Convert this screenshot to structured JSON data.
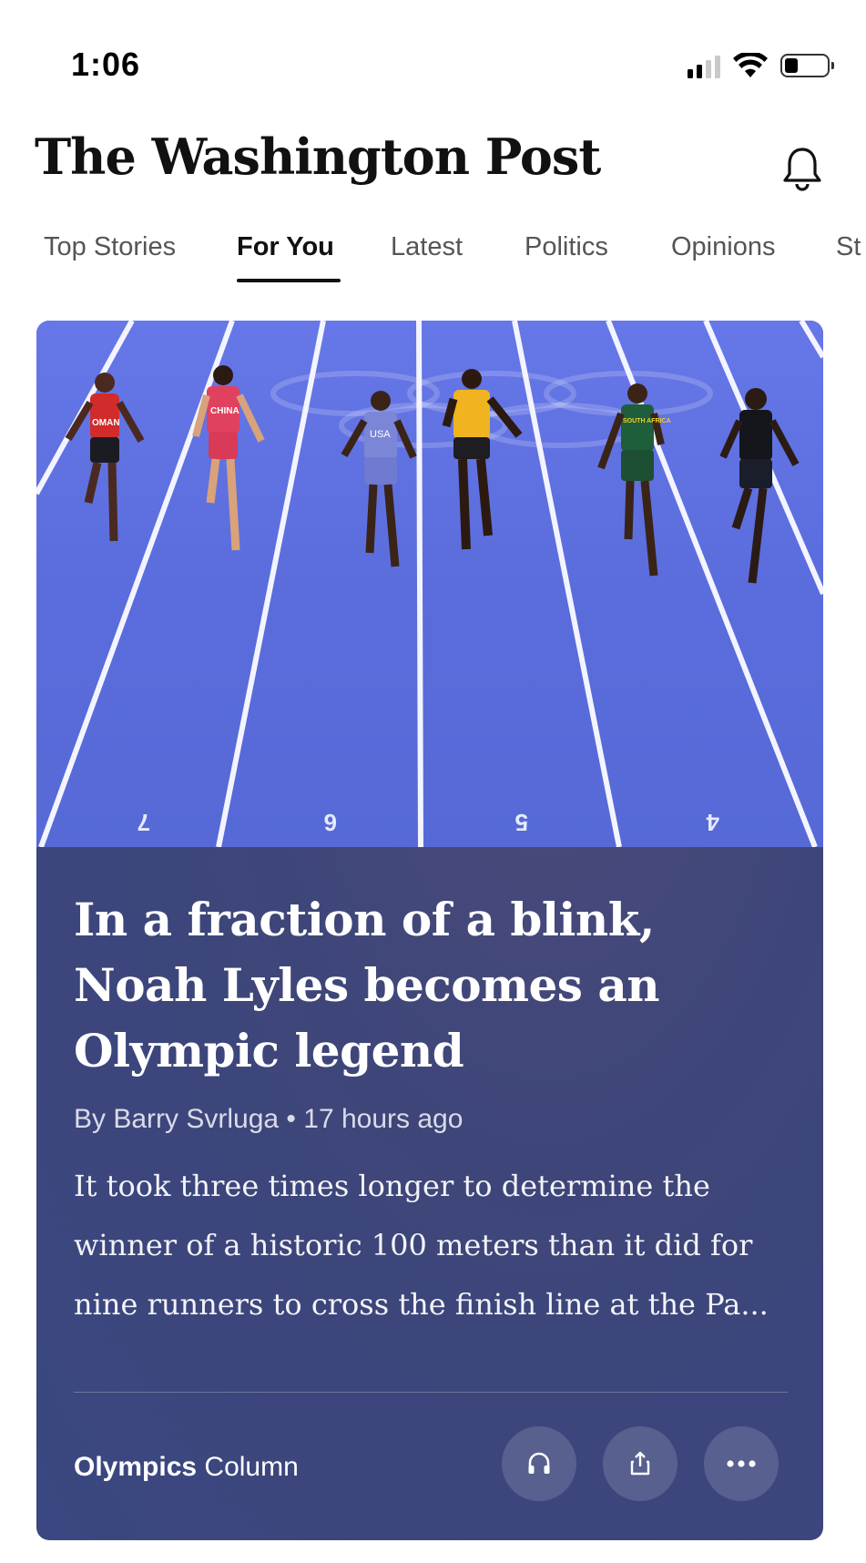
{
  "status_bar": {
    "time": "1:06"
  },
  "header": {
    "masthead": "The Washington Post"
  },
  "tabs": [
    {
      "label": "Top Stories",
      "active": false
    },
    {
      "label": "For You",
      "active": true
    },
    {
      "label": "Latest",
      "active": false
    },
    {
      "label": "Politics",
      "active": false
    },
    {
      "label": "Opinions",
      "active": false
    },
    {
      "label": "St",
      "active": false
    }
  ],
  "article": {
    "headline": "In a fraction of a blink, Noah Lyles becomes an Olympic legend",
    "author": "By Barry Svrluga",
    "separator": "•",
    "age": "17 hours ago",
    "summary": "It took three times longer to determine the winner of a historic 100 meters than it did for nine runners to cross the finish line at the Pa...",
    "section": "Olympics",
    "kind": "Column",
    "image": {
      "bibs": [
        "OMAN",
        "CHINA",
        "USA",
        "",
        "SOUTH AFRICA",
        ""
      ],
      "lane_numbers": [
        "7",
        "6",
        "5",
        "4"
      ]
    },
    "actions": [
      {
        "name": "listen",
        "icon": "headphones-icon"
      },
      {
        "name": "share",
        "icon": "share-icon"
      },
      {
        "name": "more",
        "icon": "more-icon"
      }
    ]
  },
  "colors": {
    "card_bg": "#3e4679",
    "track_blue": "#5a6ee0",
    "text_white": "#ffffff"
  }
}
